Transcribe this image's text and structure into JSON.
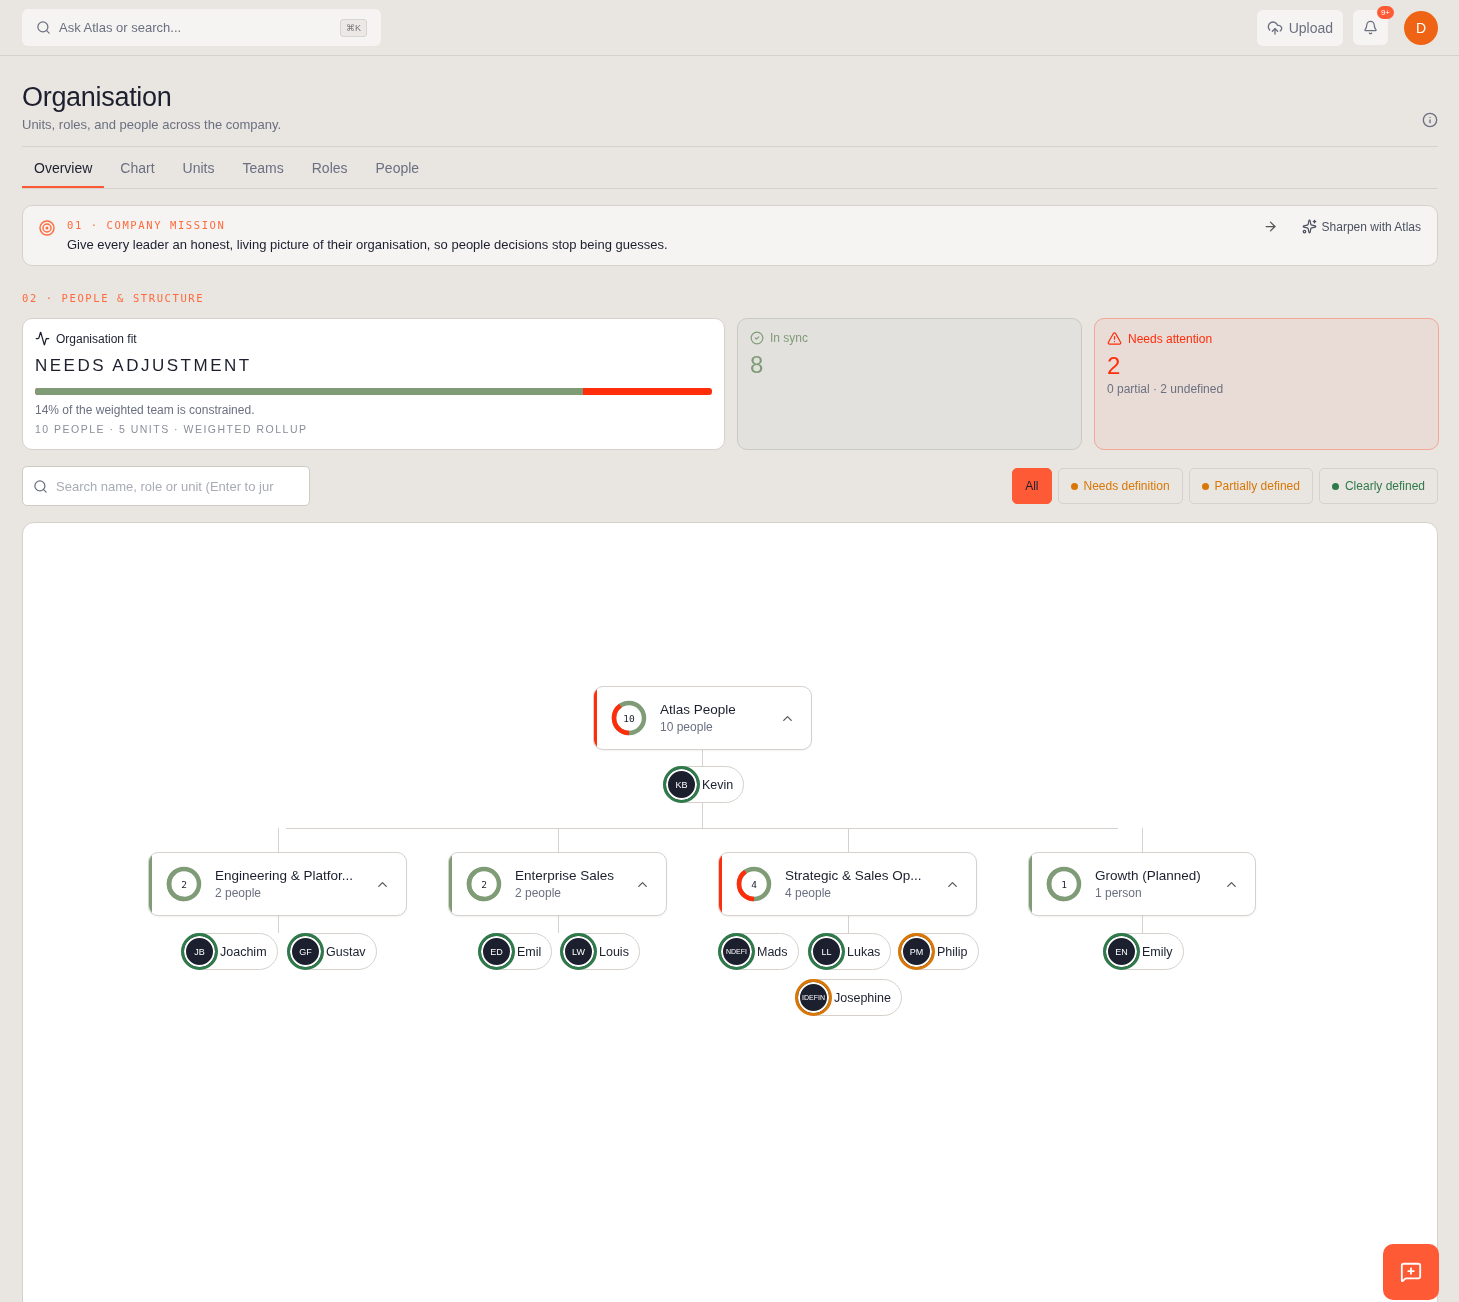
{
  "topbar": {
    "search": {
      "placeholder": "Ask Atlas or search...",
      "shortcut": "⌘K"
    },
    "upload": "Upload",
    "notifications": "9+",
    "avatar": "D"
  },
  "header": {
    "title": "Organisation",
    "subtitle": "Units, roles, and people across the company."
  },
  "tabs": [
    {
      "label": "Overview",
      "selected": true
    },
    {
      "label": "Chart",
      "selected": false
    },
    {
      "label": "Units",
      "selected": false
    },
    {
      "label": "Teams",
      "selected": false
    },
    {
      "label": "Roles",
      "selected": false
    },
    {
      "label": "People",
      "selected": false
    }
  ],
  "mission": {
    "eyebrow": "01 · COMPANY MISSION",
    "text": "Give every leader an honest, living picture of their organisation, so people decisions stop being guesses.",
    "action": "Sharpen with Atlas"
  },
  "section_label": "02 · PEOPLE & STRUCTURE",
  "fit": {
    "label": "Organisation fit",
    "status": "NEEDS ADJUSTMENT",
    "level": 0.81,
    "note": "14% of the weighted team is constrained.",
    "meta": "10 PEOPLE · 5 UNITS · WEIGHTED ROLLUP"
  },
  "in_sync": {
    "label": "In sync",
    "value": "8"
  },
  "attention": {
    "label": "Needs attention",
    "value": "2",
    "detail": "0 partial · 2 undefined"
  },
  "filter_search": {
    "placeholder": "Search name, role or unit (Enter to jur"
  },
  "filters": [
    {
      "label": "All",
      "selected": true
    },
    {
      "label": "Needs definition",
      "selected": false,
      "color": "#d97706"
    },
    {
      "label": "Partially defined",
      "selected": false,
      "color": "#d97706"
    },
    {
      "label": "Clearly defined",
      "selected": false,
      "color": "#2f7a4a"
    }
  ],
  "chart": {
    "root": {
      "name": "Atlas People",
      "count": "10",
      "people_label": "10 people",
      "color": "#ff2d0a",
      "people": [
        {
          "initials": "KB",
          "name": "Kevin",
          "color": "#2f7a4a"
        }
      ]
    },
    "units": [
      {
        "name": "Engineering & Platfor...",
        "count": "2",
        "people_label": "2 people",
        "color": "#7f9c77",
        "people": [
          {
            "initials": "JB",
            "name": "Joachim",
            "color": "#2f7a4a"
          },
          {
            "initials": "GF",
            "name": "Gustav",
            "color": "#2f7a4a"
          }
        ]
      },
      {
        "name": "Enterprise Sales",
        "count": "2",
        "people_label": "2 people",
        "color": "#7f9c77",
        "people": [
          {
            "initials": "ED",
            "name": "Emil",
            "color": "#2f7a4a"
          },
          {
            "initials": "LW",
            "name": "Louis",
            "color": "#2f7a4a"
          }
        ]
      },
      {
        "name": "Strategic & Sales Op...",
        "count": "4",
        "people_label": "4 people",
        "color": "#ff2d0a",
        "people": [
          {
            "initials": "NDEFI",
            "name": "Mads",
            "color": "#2f7a4a"
          },
          {
            "initials": "LL",
            "name": "Lukas",
            "color": "#2f7a4a"
          },
          {
            "initials": "PM",
            "name": "Philip",
            "color": "#d97706"
          },
          {
            "initials": "IDEFIN",
            "name": "Josephine",
            "color": "#d97706"
          }
        ]
      },
      {
        "name": "Growth (Planned)",
        "count": "1",
        "people_label": "1 person",
        "color": "#7f9c77",
        "people": [
          {
            "initials": "EN",
            "name": "Emily",
            "color": "#2f7a4a"
          }
        ]
      }
    ]
  }
}
